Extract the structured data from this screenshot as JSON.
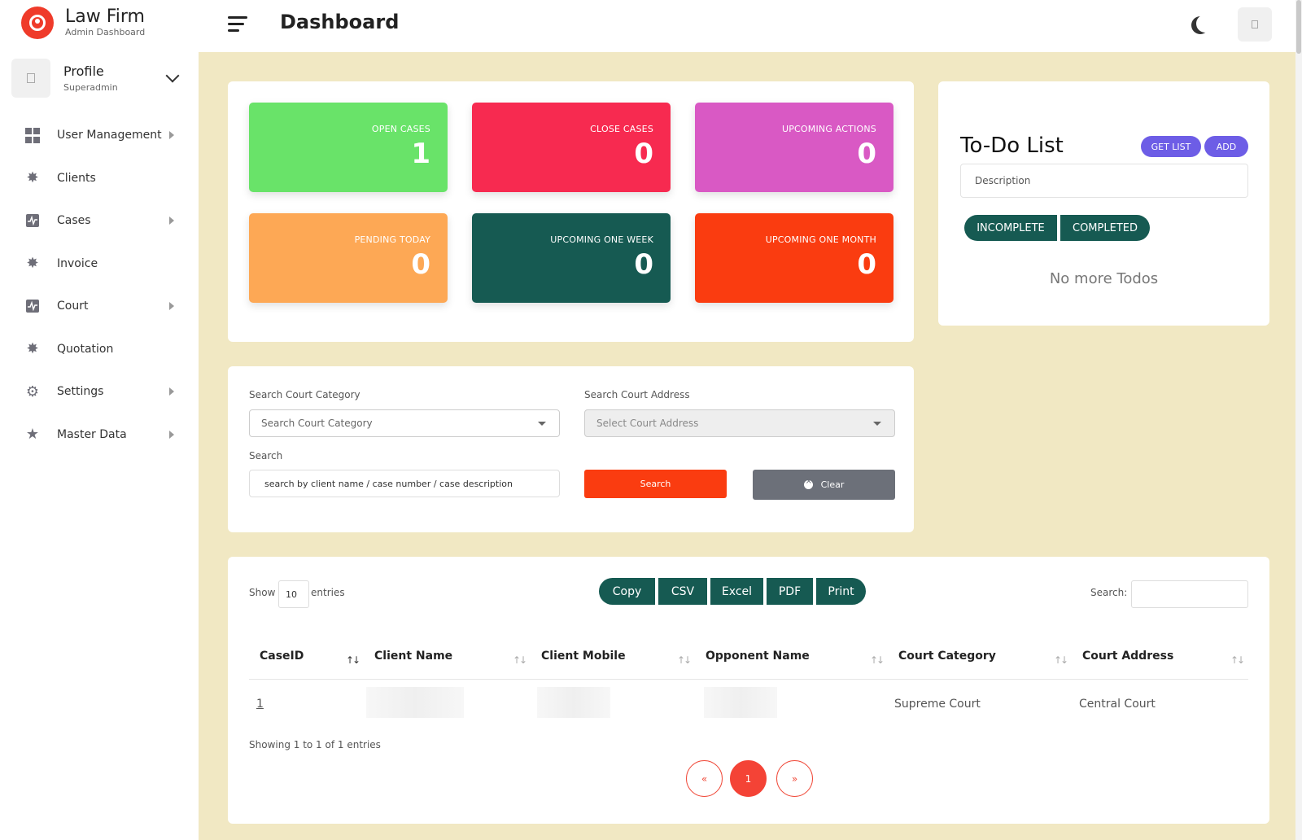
{
  "brand": {
    "name": "Law Firm",
    "subtitle": "Admin Dashboard"
  },
  "profile": {
    "name": "Profile",
    "role": "Superadmin"
  },
  "sidebar": {
    "items": [
      {
        "label": "User Management",
        "icon": "dashboard-grid-icon",
        "has_submenu": true
      },
      {
        "label": "Clients",
        "icon": "badge-check-icon",
        "has_submenu": false
      },
      {
        "label": "Cases",
        "icon": "activity-icon",
        "has_submenu": true
      },
      {
        "label": "Invoice",
        "icon": "badge-check-icon",
        "has_submenu": false
      },
      {
        "label": "Court",
        "icon": "activity-icon",
        "has_submenu": true
      },
      {
        "label": "Quotation",
        "icon": "badge-check-icon",
        "has_submenu": false
      },
      {
        "label": "Settings",
        "icon": "gear-icon",
        "has_submenu": true
      },
      {
        "label": "Master Data",
        "icon": "star-icon",
        "has_submenu": true
      }
    ]
  },
  "header": {
    "title": "Dashboard"
  },
  "stats": [
    {
      "label": "OPEN CASES",
      "value": "1",
      "color": "#69e369"
    },
    {
      "label": "CLOSE CASES",
      "value": "0",
      "color": "#f72a50"
    },
    {
      "label": "UPCOMING ACTIONS",
      "value": "0",
      "color": "#d959c4"
    },
    {
      "label": "PENDING TODAY",
      "value": "0",
      "color": "#fda855"
    },
    {
      "label": "UPCOMING ONE WEEK",
      "value": "0",
      "color": "#165a52"
    },
    {
      "label": "UPCOMING ONE MONTH",
      "value": "0",
      "color": "#fa3c10"
    }
  ],
  "todo": {
    "title": "To-Do List",
    "get_list_label": "GET LIST",
    "add_label": "ADD",
    "description_placeholder": "Description",
    "incomplete_label": "INCOMPLETE",
    "completed_label": "COMPLETED",
    "empty_text": "No more Todos"
  },
  "search": {
    "court_category_label": "Search Court Category",
    "court_category_placeholder": "Search Court Category",
    "court_address_label": "Search Court Address",
    "court_address_placeholder": "Select Court Address",
    "search_label": "Search",
    "search_placeholder": "search by client name / case number / case description",
    "search_button": "Search",
    "clear_button": "Clear"
  },
  "table": {
    "show_label": "Show",
    "entries_label": "entries",
    "page_length": "10",
    "export_buttons": [
      "Copy",
      "CSV",
      "Excel",
      "PDF",
      "Print"
    ],
    "search_label": "Search:",
    "columns": [
      "CaseID",
      "Client Name",
      "Client Mobile",
      "Opponent Name",
      "Court Category",
      "Court Address"
    ],
    "rows": [
      {
        "case_id": "1",
        "client_name": "",
        "client_mobile": "",
        "opponent_name": "",
        "court_category": "Supreme Court",
        "court_address": "Central Court"
      }
    ],
    "info": "Showing 1 to 1 of 1 entries",
    "pagination": {
      "prev": "«",
      "current": "1",
      "next": "»"
    }
  },
  "colors": {
    "accent_dark": "#165a52",
    "accent_purple": "#6d5de6",
    "search_red": "#fa3c10",
    "clear_gray": "#6c7079",
    "page_background": "#f1e8c3"
  }
}
